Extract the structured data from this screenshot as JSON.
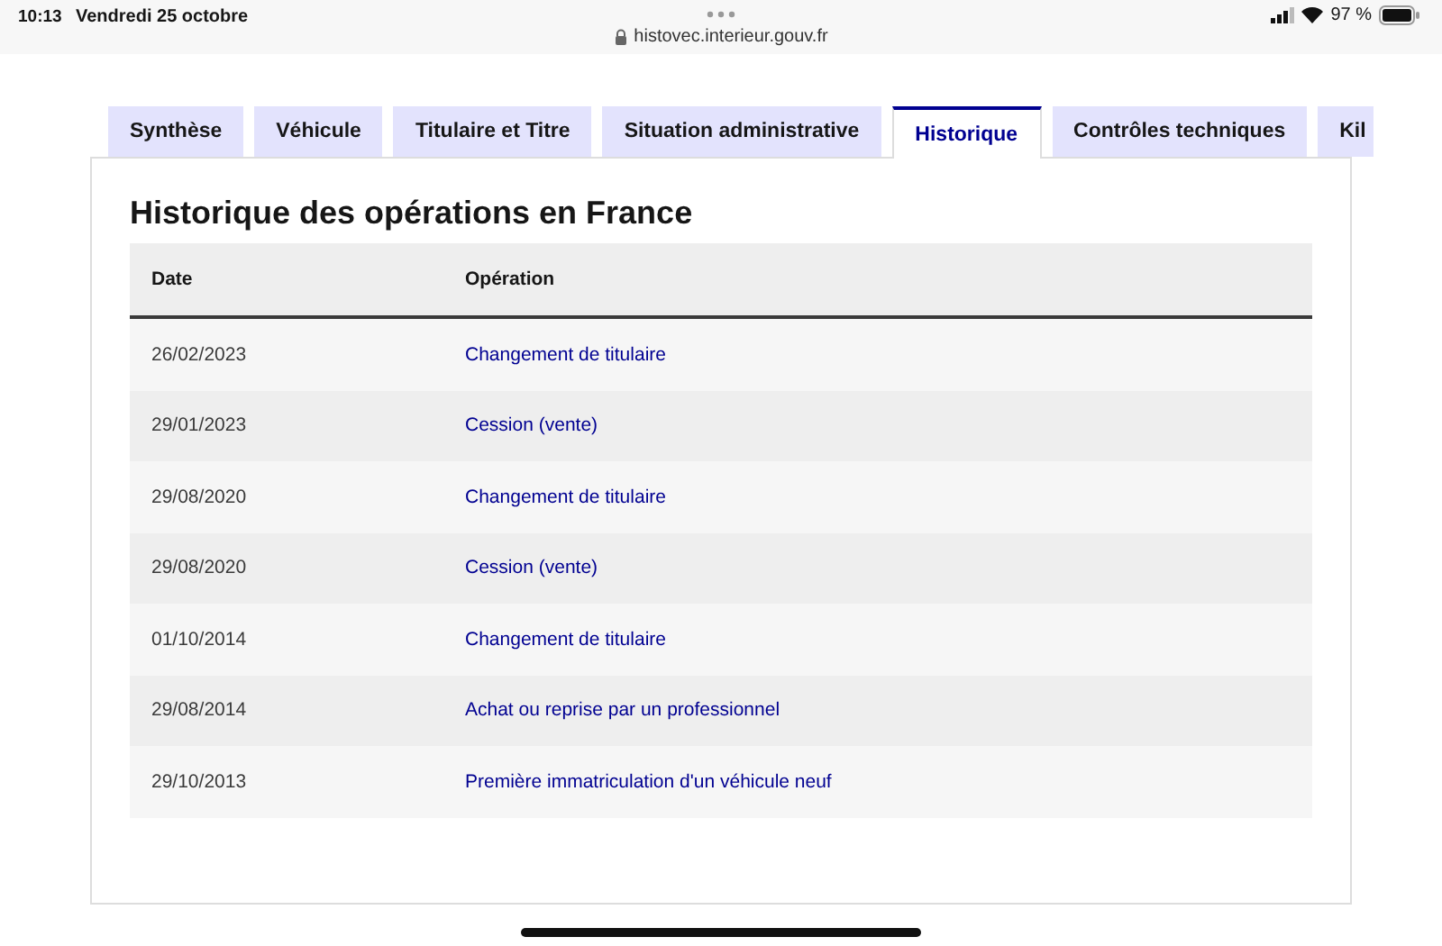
{
  "status_bar": {
    "time": "10:13",
    "date": "Vendredi 25 octobre",
    "url": "histovec.interieur.gouv.fr",
    "battery": "97 %"
  },
  "tabs": [
    {
      "label": "Synthèse",
      "selected": false
    },
    {
      "label": "Véhicule",
      "selected": false
    },
    {
      "label": "Titulaire et Titre",
      "selected": false
    },
    {
      "label": "Situation administrative",
      "selected": false
    },
    {
      "label": "Historique",
      "selected": true
    },
    {
      "label": "Contrôles techniques",
      "selected": false
    },
    {
      "label": "Kil",
      "selected": false
    }
  ],
  "heading": "Historique des opérations en France",
  "table": {
    "columns": [
      "Date",
      "Opération"
    ],
    "rows": [
      {
        "date": "26/02/2023",
        "operation": "Changement de titulaire"
      },
      {
        "date": "29/01/2023",
        "operation": "Cession (vente)"
      },
      {
        "date": "29/08/2020",
        "operation": "Changement de titulaire"
      },
      {
        "date": "29/08/2020",
        "operation": "Cession (vente)"
      },
      {
        "date": "01/10/2014",
        "operation": "Changement de titulaire"
      },
      {
        "date": "29/08/2014",
        "operation": "Achat ou reprise par un professionnel"
      },
      {
        "date": "29/10/2013",
        "operation": "Première immatriculation d'un véhicule neuf"
      }
    ]
  }
}
